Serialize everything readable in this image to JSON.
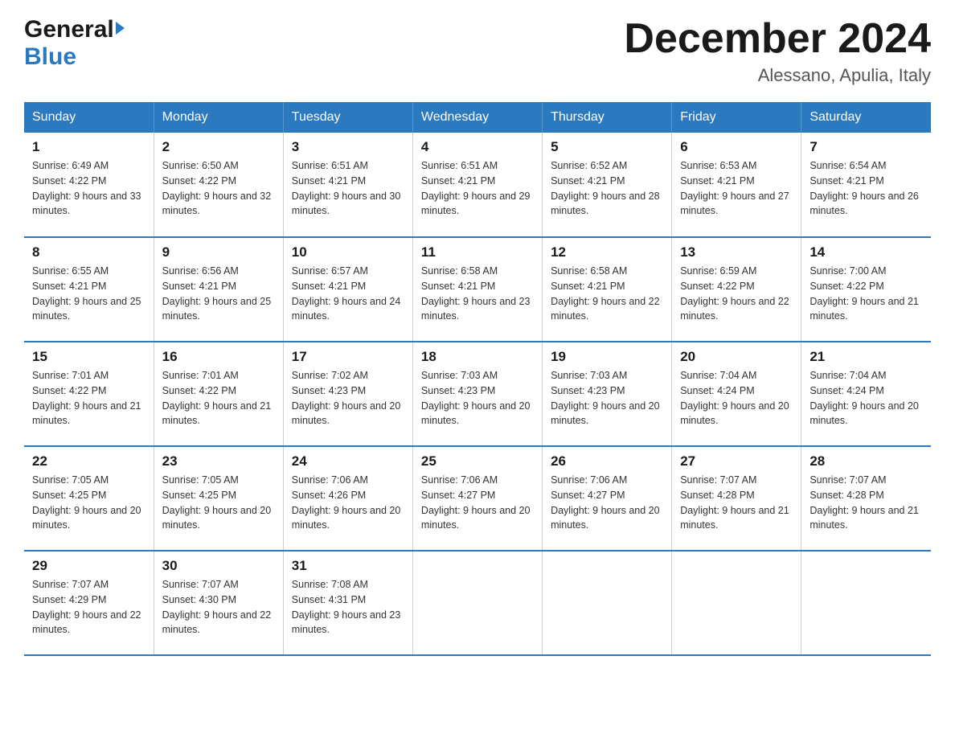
{
  "header": {
    "logo_general": "General",
    "logo_blue": "Blue",
    "month_title": "December 2024",
    "location": "Alessano, Apulia, Italy"
  },
  "days_of_week": [
    "Sunday",
    "Monday",
    "Tuesday",
    "Wednesday",
    "Thursday",
    "Friday",
    "Saturday"
  ],
  "weeks": [
    [
      {
        "num": "1",
        "sunrise": "6:49 AM",
        "sunset": "4:22 PM",
        "daylight": "9 hours and 33 minutes."
      },
      {
        "num": "2",
        "sunrise": "6:50 AM",
        "sunset": "4:22 PM",
        "daylight": "9 hours and 32 minutes."
      },
      {
        "num": "3",
        "sunrise": "6:51 AM",
        "sunset": "4:21 PM",
        "daylight": "9 hours and 30 minutes."
      },
      {
        "num": "4",
        "sunrise": "6:51 AM",
        "sunset": "4:21 PM",
        "daylight": "9 hours and 29 minutes."
      },
      {
        "num": "5",
        "sunrise": "6:52 AM",
        "sunset": "4:21 PM",
        "daylight": "9 hours and 28 minutes."
      },
      {
        "num": "6",
        "sunrise": "6:53 AM",
        "sunset": "4:21 PM",
        "daylight": "9 hours and 27 minutes."
      },
      {
        "num": "7",
        "sunrise": "6:54 AM",
        "sunset": "4:21 PM",
        "daylight": "9 hours and 26 minutes."
      }
    ],
    [
      {
        "num": "8",
        "sunrise": "6:55 AM",
        "sunset": "4:21 PM",
        "daylight": "9 hours and 25 minutes."
      },
      {
        "num": "9",
        "sunrise": "6:56 AM",
        "sunset": "4:21 PM",
        "daylight": "9 hours and 25 minutes."
      },
      {
        "num": "10",
        "sunrise": "6:57 AM",
        "sunset": "4:21 PM",
        "daylight": "9 hours and 24 minutes."
      },
      {
        "num": "11",
        "sunrise": "6:58 AM",
        "sunset": "4:21 PM",
        "daylight": "9 hours and 23 minutes."
      },
      {
        "num": "12",
        "sunrise": "6:58 AM",
        "sunset": "4:21 PM",
        "daylight": "9 hours and 22 minutes."
      },
      {
        "num": "13",
        "sunrise": "6:59 AM",
        "sunset": "4:22 PM",
        "daylight": "9 hours and 22 minutes."
      },
      {
        "num": "14",
        "sunrise": "7:00 AM",
        "sunset": "4:22 PM",
        "daylight": "9 hours and 21 minutes."
      }
    ],
    [
      {
        "num": "15",
        "sunrise": "7:01 AM",
        "sunset": "4:22 PM",
        "daylight": "9 hours and 21 minutes."
      },
      {
        "num": "16",
        "sunrise": "7:01 AM",
        "sunset": "4:22 PM",
        "daylight": "9 hours and 21 minutes."
      },
      {
        "num": "17",
        "sunrise": "7:02 AM",
        "sunset": "4:23 PM",
        "daylight": "9 hours and 20 minutes."
      },
      {
        "num": "18",
        "sunrise": "7:03 AM",
        "sunset": "4:23 PM",
        "daylight": "9 hours and 20 minutes."
      },
      {
        "num": "19",
        "sunrise": "7:03 AM",
        "sunset": "4:23 PM",
        "daylight": "9 hours and 20 minutes."
      },
      {
        "num": "20",
        "sunrise": "7:04 AM",
        "sunset": "4:24 PM",
        "daylight": "9 hours and 20 minutes."
      },
      {
        "num": "21",
        "sunrise": "7:04 AM",
        "sunset": "4:24 PM",
        "daylight": "9 hours and 20 minutes."
      }
    ],
    [
      {
        "num": "22",
        "sunrise": "7:05 AM",
        "sunset": "4:25 PM",
        "daylight": "9 hours and 20 minutes."
      },
      {
        "num": "23",
        "sunrise": "7:05 AM",
        "sunset": "4:25 PM",
        "daylight": "9 hours and 20 minutes."
      },
      {
        "num": "24",
        "sunrise": "7:06 AM",
        "sunset": "4:26 PM",
        "daylight": "9 hours and 20 minutes."
      },
      {
        "num": "25",
        "sunrise": "7:06 AM",
        "sunset": "4:27 PM",
        "daylight": "9 hours and 20 minutes."
      },
      {
        "num": "26",
        "sunrise": "7:06 AM",
        "sunset": "4:27 PM",
        "daylight": "9 hours and 20 minutes."
      },
      {
        "num": "27",
        "sunrise": "7:07 AM",
        "sunset": "4:28 PM",
        "daylight": "9 hours and 21 minutes."
      },
      {
        "num": "28",
        "sunrise": "7:07 AM",
        "sunset": "4:28 PM",
        "daylight": "9 hours and 21 minutes."
      }
    ],
    [
      {
        "num": "29",
        "sunrise": "7:07 AM",
        "sunset": "4:29 PM",
        "daylight": "9 hours and 22 minutes."
      },
      {
        "num": "30",
        "sunrise": "7:07 AM",
        "sunset": "4:30 PM",
        "daylight": "9 hours and 22 minutes."
      },
      {
        "num": "31",
        "sunrise": "7:08 AM",
        "sunset": "4:31 PM",
        "daylight": "9 hours and 23 minutes."
      },
      null,
      null,
      null,
      null
    ]
  ]
}
